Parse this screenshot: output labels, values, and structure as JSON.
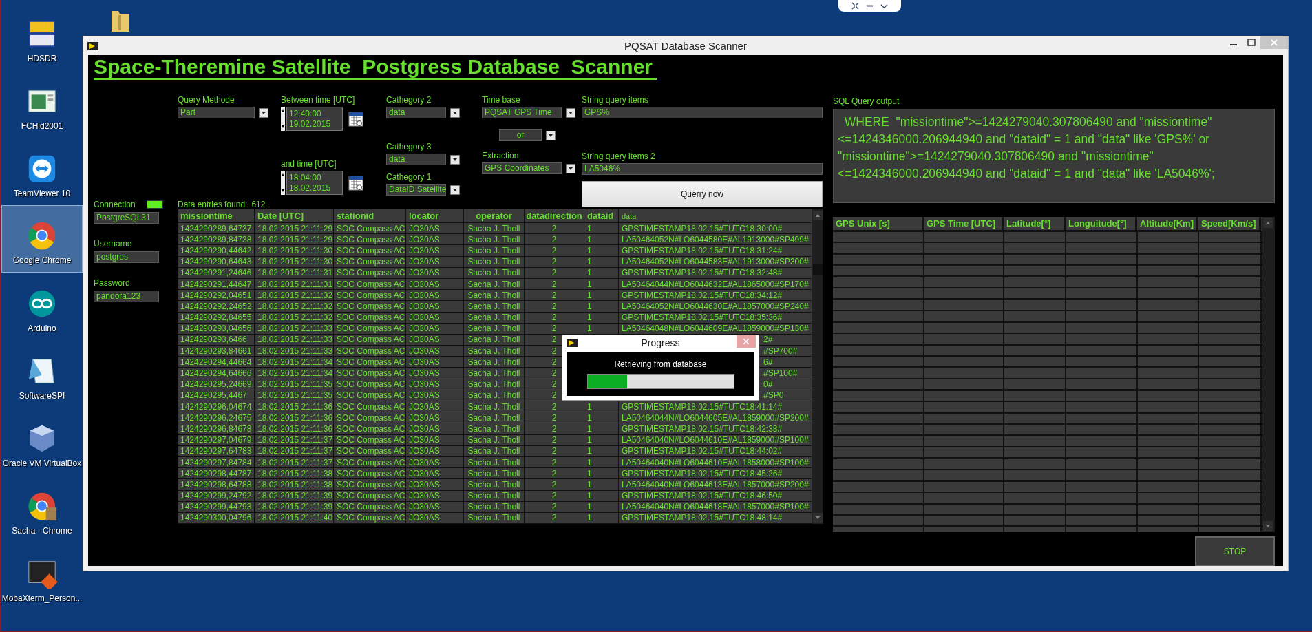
{
  "desktop": {
    "icons": [
      {
        "label": "HDSDR",
        "selected": false
      },
      {
        "label": "FCHid2001",
        "selected": false
      },
      {
        "label": "TeamViewer 10",
        "selected": false
      },
      {
        "label": "Google Chrome",
        "selected": true
      },
      {
        "label": "Arduino",
        "selected": false
      },
      {
        "label": "SoftwareSPI",
        "selected": false
      },
      {
        "label": "Oracle VM VirtualBox",
        "selected": false
      },
      {
        "label": "Sacha - Chrome",
        "selected": false
      },
      {
        "label": "MobaXterm_Person...",
        "selected": false
      }
    ]
  },
  "window": {
    "title": "PQSAT Database Scanner"
  },
  "heading": "Space-Theremine Satellite  Postgress Database  Scanner",
  "query": {
    "method_label": "Query Methode",
    "method": "Part",
    "between_label": "Between time [UTC]",
    "between_time": "12:40:00",
    "between_date": "19.02.2015",
    "and_label": "and time [UTC]",
    "and_time": "18:04:00",
    "and_date": "18.02.2015",
    "cat2_label": "Cathegory 2",
    "cat2": "data",
    "cat3_label": "Cathegory 3",
    "cat3": "data",
    "cat1_label": "Cathegory 1",
    "cat1": "DataID Satellite",
    "timebase_label": "Time base",
    "timebase": "PQSAT GPS Time",
    "combine": "or",
    "extraction_label": "Extraction",
    "extraction": "GPS Coordinates",
    "string1_label": "String query items",
    "string1": "GPS%",
    "string2_label": "String query items 2",
    "string2": "LA5046%",
    "run_button": "Querry now"
  },
  "connection": {
    "label": "Connection",
    "on": true,
    "server": "PostgreSQL31",
    "username_label": "Username",
    "username": "postgres",
    "password_label": "Password",
    "password": "pandora123"
  },
  "entries": {
    "label": "Data entries found:",
    "count": "612"
  },
  "table": {
    "columns": [
      "missiontime",
      "Date [UTC]",
      "stationid",
      "locator",
      "operator",
      "datadirection",
      "dataid",
      "data"
    ],
    "rows": [
      {
        "missiontime": "1424290289,64737",
        "date": "18.02.2015 21:11:29",
        "stationid": "SOC Compass AC",
        "locator": "JO30AS",
        "operator": "Sacha J. Tholl",
        "datadirection": "2",
        "dataid": "1",
        "data": "GPSTIMESTAMP18.02.15#TUTC18:30:00#"
      },
      {
        "missiontime": "1424290289,84738",
        "date": "18.02.2015 21:11:29",
        "stationid": "SOC Compass AC",
        "locator": "JO30AS",
        "operator": "Sacha J. Tholl",
        "datadirection": "2",
        "dataid": "1",
        "data": "LA50464052N#LO6044580E#AL1913000#SP499#"
      },
      {
        "missiontime": "1424290290,44642",
        "date": "18.02.2015 21:11:30",
        "stationid": "SOC Compass AC",
        "locator": "JO30AS",
        "operator": "Sacha J. Tholl",
        "datadirection": "2",
        "dataid": "1",
        "data": "GPSTIMESTAMP18.02.15#TUTC18:31:24#"
      },
      {
        "missiontime": "1424290290,64643",
        "date": "18.02.2015 21:11:30",
        "stationid": "SOC Compass AC",
        "locator": "JO30AS",
        "operator": "Sacha J. Tholl",
        "datadirection": "2",
        "dataid": "1",
        "data": "LA50464052N#LO6044583E#AL1913000#SP300#"
      },
      {
        "missiontime": "1424290291,24646",
        "date": "18.02.2015 21:11:31",
        "stationid": "SOC Compass AC",
        "locator": "JO30AS",
        "operator": "Sacha J. Tholl",
        "datadirection": "2",
        "dataid": "1",
        "data": "GPSTIMESTAMP18.02.15#TUTC18:32:48#"
      },
      {
        "missiontime": "1424290291,44647",
        "date": "18.02.2015 21:11:31",
        "stationid": "SOC Compass AC",
        "locator": "JO30AS",
        "operator": "Sacha J. Tholl",
        "datadirection": "2",
        "dataid": "1",
        "data": "LA50464044N#LO6044632E#AL1865000#SP170#"
      },
      {
        "missiontime": "1424290292,04651",
        "date": "18.02.2015 21:11:32",
        "stationid": "SOC Compass AC",
        "locator": "JO30AS",
        "operator": "Sacha J. Tholl",
        "datadirection": "2",
        "dataid": "1",
        "data": "GPSTIMESTAMP18.02.15#TUTC18:34:12#"
      },
      {
        "missiontime": "1424290292,24652",
        "date": "18.02.2015 21:11:32",
        "stationid": "SOC Compass AC",
        "locator": "JO30AS",
        "operator": "Sacha J. Tholl",
        "datadirection": "2",
        "dataid": "1",
        "data": "LA50464052N#LO6044630E#AL1857000#SP240#"
      },
      {
        "missiontime": "1424290292,84655",
        "date": "18.02.2015 21:11:32",
        "stationid": "SOC Compass AC",
        "locator": "JO30AS",
        "operator": "Sacha J. Tholl",
        "datadirection": "2",
        "dataid": "1",
        "data": "GPSTIMESTAMP18.02.15#TUTC18:35:36#"
      },
      {
        "missiontime": "1424290293,04656",
        "date": "18.02.2015 21:11:33",
        "stationid": "SOC Compass AC",
        "locator": "JO30AS",
        "operator": "Sacha J. Tholl",
        "datadirection": "2",
        "dataid": "1",
        "data": "LA50464048N#LO6044609E#AL1859000#SP130#"
      },
      {
        "missiontime": "1424290293,6466",
        "date": "18.02.2015 21:11:33",
        "stationid": "SOC Compass AC",
        "locator": "JO30AS",
        "operator": "Sacha J. Tholl",
        "datadirection": "2",
        "data_tail": "2#"
      },
      {
        "missiontime": "1424290293,84661",
        "date": "18.02.2015 21:11:33",
        "stationid": "SOC Compass AC",
        "locator": "JO30AS",
        "operator": "Sacha J. Tholl",
        "datadirection": "2",
        "data_tail": "#SP700#"
      },
      {
        "missiontime": "1424290294,44664",
        "date": "18.02.2015 21:11:34",
        "stationid": "SOC Compass AC",
        "locator": "JO30AS",
        "operator": "Sacha J. Tholl",
        "datadirection": "2",
        "data_tail": "6#"
      },
      {
        "missiontime": "1424290294,64666",
        "date": "18.02.2015 21:11:34",
        "stationid": "SOC Compass AC",
        "locator": "JO30AS",
        "operator": "Sacha J. Tholl",
        "datadirection": "2",
        "data_tail": "#SP100#"
      },
      {
        "missiontime": "1424290295,24669",
        "date": "18.02.2015 21:11:35",
        "stationid": "SOC Compass AC",
        "locator": "JO30AS",
        "operator": "Sacha J. Tholl",
        "datadirection": "2",
        "data_tail": "0#"
      },
      {
        "missiontime": "1424290295,4467",
        "date": "18.02.2015 21:11:35",
        "stationid": "SOC Compass AC",
        "locator": "JO30AS",
        "operator": "Sacha J. Tholl",
        "datadirection": "2",
        "data_tail": "#SP0"
      },
      {
        "missiontime": "1424290296,04674",
        "date": "18.02.2015 21:11:36",
        "stationid": "SOC Compass AC",
        "locator": "JO30AS",
        "operator": "Sacha J. Tholl",
        "datadirection": "2",
        "dataid": "1",
        "data": "GPSTIMESTAMP18.02.15#TUTC18:41:14#"
      },
      {
        "missiontime": "1424290296,24675",
        "date": "18.02.2015 21:11:36",
        "stationid": "SOC Compass AC",
        "locator": "JO30AS",
        "operator": "Sacha J. Tholl",
        "datadirection": "2",
        "dataid": "1",
        "data": "LA50464044N#LO6044605E#AL1859000#SP200#"
      },
      {
        "missiontime": "1424290296,84678",
        "date": "18.02.2015 21:11:36",
        "stationid": "SOC Compass AC",
        "locator": "JO30AS",
        "operator": "Sacha J. Tholl",
        "datadirection": "2",
        "dataid": "1",
        "data": "GPSTIMESTAMP18.02.15#TUTC18:42:38#"
      },
      {
        "missiontime": "1424290297,04679",
        "date": "18.02.2015 21:11:37",
        "stationid": "SOC Compass AC",
        "locator": "JO30AS",
        "operator": "Sacha J. Tholl",
        "datadirection": "2",
        "dataid": "1",
        "data": "LA50464040N#LO6044610E#AL1859000#SP100#"
      },
      {
        "missiontime": "1424290297,64783",
        "date": "18.02.2015 21:11:37",
        "stationid": "SOC Compass AC",
        "locator": "JO30AS",
        "operator": "Sacha J. Tholl",
        "datadirection": "2",
        "dataid": "1",
        "data": "GPSTIMESTAMP18.02.15#TUTC18:44:02#"
      },
      {
        "missiontime": "1424290297,84784",
        "date": "18.02.2015 21:11:37",
        "stationid": "SOC Compass AC",
        "locator": "JO30AS",
        "operator": "Sacha J. Tholl",
        "datadirection": "2",
        "dataid": "1",
        "data": "LA50464040N#LO6044610E#AL1858000#SP100#"
      },
      {
        "missiontime": "1424290298,44787",
        "date": "18.02.2015 21:11:38",
        "stationid": "SOC Compass AC",
        "locator": "JO30AS",
        "operator": "Sacha J. Tholl",
        "datadirection": "2",
        "dataid": "1",
        "data": "GPSTIMESTAMP18.02.15#TUTC18:45:26#"
      },
      {
        "missiontime": "1424290298,64788",
        "date": "18.02.2015 21:11:38",
        "stationid": "SOC Compass AC",
        "locator": "JO30AS",
        "operator": "Sacha J. Tholl",
        "datadirection": "2",
        "dataid": "1",
        "data": "LA50464040N#LO6044613E#AL1857000#SP200#"
      },
      {
        "missiontime": "1424290299,24792",
        "date": "18.02.2015 21:11:39",
        "stationid": "SOC Compass AC",
        "locator": "JO30AS",
        "operator": "Sacha J. Tholl",
        "datadirection": "2",
        "dataid": "1",
        "data": "GPSTIMESTAMP18.02.15#TUTC18:46:50#"
      },
      {
        "missiontime": "1424290299,44793",
        "date": "18.02.2015 21:11:39",
        "stationid": "SOC Compass AC",
        "locator": "JO30AS",
        "operator": "Sacha J. Tholl",
        "datadirection": "2",
        "dataid": "1",
        "data": "LA50464040N#LO6044618E#AL1857000#SP100#"
      },
      {
        "missiontime": "1424290300,04796",
        "date": "18.02.2015 21:11:40",
        "stationid": "SOC Compass AC",
        "locator": "JO30AS",
        "operator": "Sacha J. Tholl",
        "datadirection": "2",
        "dataid": "1",
        "data": "GPSTIMESTAMP18.02.15#TUTC18:48:14#"
      }
    ]
  },
  "sql": {
    "label": "SQL Query output",
    "text": "  WHERE  \"missiontime\">=1424279040.307806490 and \"missiontime\"<=1424346000.206944940 and \"dataid\" = 1 and \"data\" like 'GPS%' or   \"missiontime\">=1424279040.307806490 and \"missiontime\"<=1424346000.206944940 and \"dataid\" = 1 and \"data\" like 'LA5046%';"
  },
  "gps_table": {
    "columns": [
      "GPS Unix [s]",
      "GPS Time [UTC]",
      "Latitude[°]",
      "Longuitude[°]",
      "Altitude[Km]",
      "Speed[Km/s]"
    ]
  },
  "stop_button": "STOP",
  "progress": {
    "title": "Progress",
    "message": "Retrieving from database",
    "level": 0.27
  }
}
